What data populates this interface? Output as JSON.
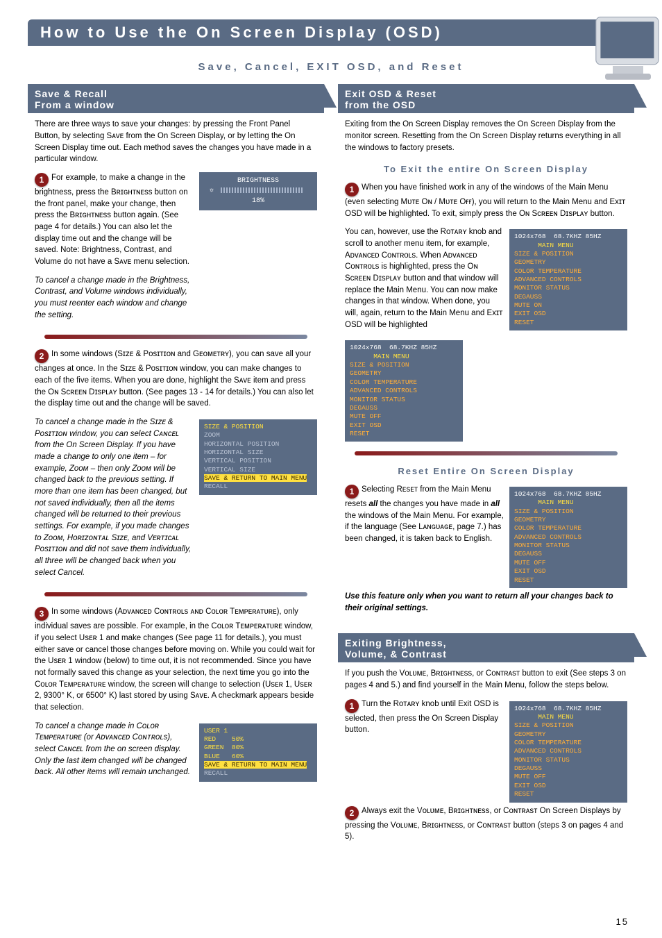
{
  "page": {
    "title": "How to Use the On Screen Display (OSD)",
    "subtitle": "Save, Cancel, EXIT OSD, and Reset",
    "page_number": "15"
  },
  "left": {
    "header_l1": "Save & Recall",
    "header_l2": "From a window",
    "intro": "There are three ways to save your changes: by pressing the Front Panel Button, by selecting Sᴀᴠᴇ from the On Screen Display, or by letting the On Screen Display time out. Each method saves the changes you have made in a particular window.",
    "s1a": "For example, to make a change in the brightness, press the Bʀɪɢʜᴛɴᴇss button on the front panel, make your change, then press the Bʀɪɢʜᴛɴᴇss button again. (See page 4 for details.) You can also let the display time out and the change will be saved. Note: Brightness, Contrast, and Volume do not have a Sᴀᴠᴇ menu selection.",
    "s1b_ital": "To cancel a change made in the Brightness, Contrast, and Volume windows individually, you must reenter each window and change the setting.",
    "bright_osd_label": "BRIGHTNESS",
    "bright_osd_value": "18%",
    "s2a": "In some windows (Sɪᴢᴇ & Pᴏsɪᴛɪᴏɴ and Gᴇᴏᴍᴇᴛʀʏ), you can save all your changes at once. In the Sɪᴢᴇ & Pᴏsɪᴛɪᴏɴ window, you can make changes to each of the five items. When you are done, highlight the Sᴀᴠᴇ item and press the Oɴ Sᴄʀᴇᴇɴ Dɪsᴘʟᴀʏ button. (See pages 13 - 14 for details.) You can also let the display time out and the change will be saved.",
    "s2b_ital": "To cancel a change made in the Sɪᴢᴇ & Pᴏsɪᴛɪᴏɴ window, you can select Cᴀɴᴄᴇʟ from the On Screen Display. If you have made a change to only one item – for example, Zᴏᴏᴍ – then only Zᴏᴏᴍ will be changed back to the previous setting. If more than one item has been changed, but not saved individually, then all the items changed will be returned to their previous settings. For example, if you made changes to Zᴏᴏᴍ, Hᴏʀɪᴢᴏɴᴛᴀʟ Sɪᴢᴇ, and Vᴇʀᴛɪᴄᴀʟ Pᴏsɪᴛɪᴏɴ and did not save them individually, all three will be changed back when you select Cancel.",
    "sizepos_title": "SIZE & POSITION",
    "sizepos_lines": "ZOOM\nHORIZONTAL POSITION\nHORIZONTAL SIZE\nVERTICAL POSITION\nVERTICAL SIZE",
    "sizepos_save": "SAVE & RETURN TO MAIN MENU",
    "sizepos_recall": "RECALL",
    "s3a": "In some windows (Aᴅᴠᴀɴᴄᴇᴅ Cᴏɴᴛʀᴏʟs ᴀɴᴅ Cᴏʟᴏʀ Tᴇᴍᴘᴇʀᴀᴛᴜʀᴇ), only individual saves are possible. For example, in the Cᴏʟᴏʀ Tᴇᴍᴘᴇʀᴀᴛᴜʀᴇ window, if you select Usᴇʀ 1 and make changes (See page 11 for details.), you must either save or cancel those changes before moving on. While you could wait for the Usᴇʀ 1 window (below) to time out, it is not recommended. Since you have not formally saved this change as your selection, the next time you go into the Cᴏʟᴏʀ Tᴇᴍᴘᴇʀᴀᴛᴜʀᴇ window, the screen will change to selection (Usᴇʀ 1, Usᴇʀ 2, 9300° K, or 6500° K) last stored by using Sᴀᴠᴇ. A checkmark appears beside that selection.",
    "s3b_ital": "To cancel a change made in Cᴏʟᴏʀ Tᴇᴍᴘᴇʀᴀᴛᴜʀᴇ (or Aᴅᴠᴀɴᴄᴇᴅ Cᴏɴᴛʀᴏʟs), select Cᴀɴᴄᴇʟ from the on screen display. Only the last item changed will be changed back. All other items will remain unchanged.",
    "user1_title": "USER 1",
    "user1_rows": "RED    50%\nGREEN  80%\nBLUE   60%",
    "user1_save": "SAVE & RETURN TO MAIN MENU",
    "user1_recall": "RECALL"
  },
  "right": {
    "hdrA_l1": "Exit OSD & Reset",
    "hdrA_l2": "from the OSD",
    "introA": "Exiting from the On Screen Display removes the On Screen Display from the monitor screen. Resetting from the On Screen Display returns everything in all the windows to factory presets.",
    "subA": "To Exit the entire On Screen Display",
    "a1a": "When you have finished work in any of the windows of the Main Menu (even selecting Mᴜᴛᴇ Oɴ / Mᴜᴛᴇ Oғғ), you will return to the Main Menu and Exɪᴛ OSD will be highlighted. To exit, simply press the Oɴ Sᴄʀᴇᴇɴ Dɪsᴘʟᴀʏ button.",
    "a1b": "You can, however, use the Rᴏᴛᴀʀʏ knob and scroll to another menu item, for example, Aᴅᴠᴀɴᴄᴇᴅ Cᴏɴᴛʀᴏʟs. When Aᴅᴠᴀɴᴄᴇᴅ Cᴏɴᴛʀᴏʟs is highlighted, press the Oɴ Sᴄʀᴇᴇɴ Dɪsᴘʟᴀʏ button and that window will replace the Main Menu. You can now make changes in that window. When done, you will, again, return to the Main Menu and Exɪᴛ OSD will be highlighted",
    "menu_mode": "1024x768  68.7KHZ 85HZ",
    "menu_caption": "MAIN MENU",
    "menu_items": "SIZE & POSITION\nGEOMETRY\nCOLOR TEMPERATURE\nADVANCED CONTROLS\nMONITOR STATUS\nDEGAUSS\nMUTE ON\nEXIT OSD\nRESET",
    "menu2_items": "SIZE & POSITION\nGEOMETRY\nCOLOR TEMPERATURE\nADVANCED CONTROLS\nMONITOR STATUS\nDEGAUSS\nMUTE OFF\nEXIT OSD\nRESET",
    "subB": "Reset Entire On Screen Display",
    "b1_pre": "Selecting Rᴇsᴇᴛ from the Main Menu resets ",
    "b1_all": "all",
    "b1_mid": " the changes you have made in ",
    "b1_post": " the windows of the Main Menu. For example, if the language (See Lᴀɴɢᴜᴀɢᴇ, page 7.) has been changed, it is taken back to English.",
    "b1_warn": "Use this feature only when you want to return all your changes back to their original settings.",
    "menu3_items": "SIZE & POSITION\nGEOMETRY\nCOLOR TEMPERATURE\nADVANCED CONTROLS\nMONITOR STATUS\nDEGAUSS\nMUTE OFF\nEXIT OSD\nRESET",
    "hdrB_l1": "Exiting Brightness,",
    "hdrB_l2": "Volume, & Contrast",
    "introB": "If you push the Vᴏʟᴜᴍᴇ, Bʀɪɢʜᴛɴᴇss, or Cᴏɴᴛʀᴀsᴛ button to exit (See steps 3 on pages 4 and 5.) and find yourself in the Main Menu, follow the steps below.",
    "c1": "Turn the Rᴏᴛᴀʀʏ knob until Exit OSD is selected, then press the On Screen Display button.",
    "menu4_items": "SIZE & POSITION\nGEOMETRY\nCOLOR TEMPERATURE\nADVANCED CONTROLS\nMONITOR STATUS\nDEGAUSS\nMUTE OFF\nEXIT OSD\nRESET",
    "c2": "Always exit the Vᴏʟᴜᴍᴇ, Bʀɪɢʜᴛɴᴇss, or Cᴏɴᴛʀᴀsᴛ On Screen Displays by pressing the Vᴏʟᴜᴍᴇ, Bʀɪɢʜᴛɴᴇss, or Cᴏɴᴛʀᴀsᴛ button (steps 3 on pages 4 and 5)."
  }
}
